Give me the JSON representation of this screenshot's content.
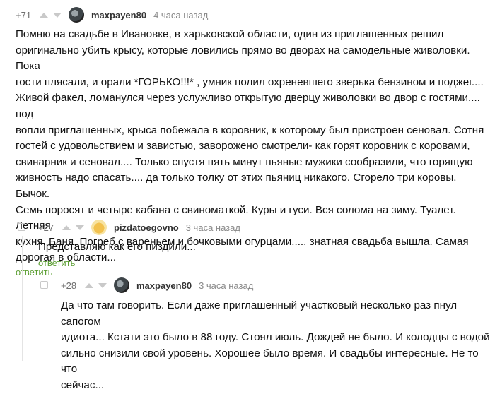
{
  "comments": [
    {
      "rating": "+71",
      "username": "maxpayen80",
      "time": "4 часа назад",
      "text": "Помню на свадьбе в Ивановке, в харьковской области, один из приглашенных решил\nоригинально убить крысу, которые ловились прямо во дворах на самодельные живоловки. Пока\nгости плясали, и орали *ГОРЬКО!!!* , умник полил охреневшего зверька бензином и поджег....\nЖивой факел, ломанулся через услужливо открытую дверцу живоловки во двор с гостями.... под\nвопли приглашенных, крыса побежала в коровник, к которому был пристроен сеновал. Сотня\nгостей с удовольствием и завистью, заворожено смотрели- как горят коровник с коровами,\nсвинарник и сеновал.... Только спустя пять минут пьяные мужики сообразили, что горящую\nживность надо спасать.... да только толку от этих пьяниц никакого. Сгорело три коровы. Бычок.\nСемь поросят и четыре кабана с свиноматкой. Куры и гуси. Вся солома на зиму. Туалет. Летняя\nкухня. Баня. Погреб с вареньем и бочковыми огурцами..... знатная свадьба вышла. Самая\nдорогая в области...",
      "reply": "ответить"
    },
    {
      "rating": "+27",
      "username": "pizdatoegovno",
      "time": "3 часа назад",
      "text": "Представляю как его пиздили...",
      "reply": "ответить"
    },
    {
      "rating": "+28",
      "username": "maxpayen80",
      "time": "3 часа назад",
      "text": "Да что там говорить. Если даже приглашенный участковый несколько раз пнул сапогом\nидиота... Кстати это было в 88 году. Стоял июль. Дождей не было. И колодцы с водой\nсильно снизили свой уровень. Хорошее было время. И свадьбы интересные. Не то что\nсейчас..."
    }
  ],
  "colors": {
    "reply_link": "#5b9e32",
    "meta": "#8a8a8a",
    "arrow": "#c9c9c9"
  }
}
